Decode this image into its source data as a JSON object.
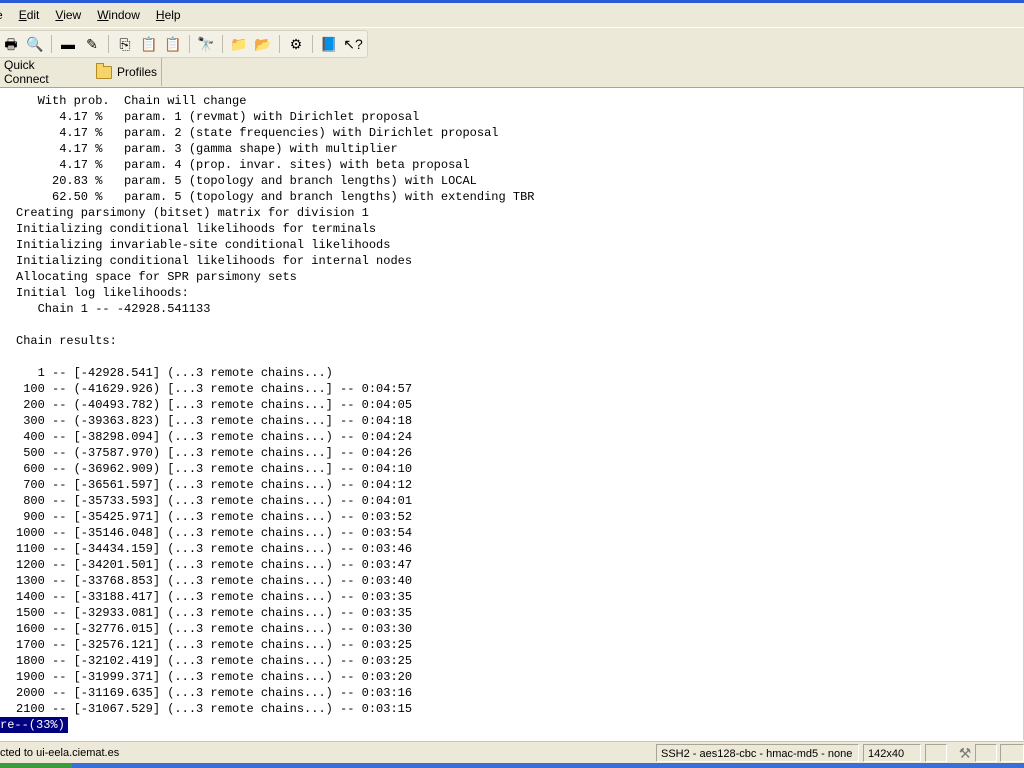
{
  "menu": {
    "items": [
      {
        "label": "e",
        "name": "menu-file-partial"
      },
      {
        "label": "Edit",
        "name": "menu-edit"
      },
      {
        "label": "View",
        "name": "menu-view"
      },
      {
        "label": "Window",
        "name": "menu-window"
      },
      {
        "label": "Help",
        "name": "menu-help"
      }
    ]
  },
  "toolbar": {
    "buttons": [
      {
        "icon": "printer-icon",
        "glyph": "🖶"
      },
      {
        "icon": "print-preview-icon",
        "glyph": "🔍"
      },
      {
        "icon": "disconnect-icon",
        "glyph": "▬"
      },
      {
        "icon": "connect-icon",
        "glyph": "✎"
      },
      {
        "icon": "copy-icon",
        "glyph": "⎘"
      },
      {
        "icon": "paste-icon",
        "glyph": "📋"
      },
      {
        "icon": "paste-alt-icon",
        "glyph": "📋"
      },
      {
        "icon": "find-icon",
        "glyph": "🔭"
      },
      {
        "icon": "new-file-transfer-icon",
        "glyph": "📁"
      },
      {
        "icon": "open-folder-icon",
        "glyph": "📂"
      },
      {
        "icon": "settings-icon",
        "glyph": "⚙"
      },
      {
        "icon": "help-book-icon",
        "glyph": "📘"
      },
      {
        "icon": "whats-this-icon",
        "glyph": "↖?"
      }
    ]
  },
  "quickbar": {
    "quick_connect_label": "Quick Connect",
    "profiles_label": "Profiles"
  },
  "terminal": {
    "lines": [
      "   With prob.  Chain will change",
      "      4.17 %   param. 1 (revmat) with Dirichlet proposal",
      "      4.17 %   param. 2 (state frequencies) with Dirichlet proposal",
      "      4.17 %   param. 3 (gamma shape) with multiplier",
      "      4.17 %   param. 4 (prop. invar. sites) with beta proposal",
      "     20.83 %   param. 5 (topology and branch lengths) with LOCAL",
      "     62.50 %   param. 5 (topology and branch lengths) with extending TBR",
      "Creating parsimony (bitset) matrix for division 1",
      "Initializing conditional likelihoods for terminals",
      "Initializing invariable-site conditional likelihoods",
      "Initializing conditional likelihoods for internal nodes",
      "Allocating space for SPR parsimony sets",
      "Initial log likelihoods:",
      "   Chain 1 -- -42928.541133",
      "",
      "Chain results:",
      "",
      "   1 -- [-42928.541] (...3 remote chains...)",
      " 100 -- (-41629.926) [...3 remote chains...] -- 0:04:57",
      " 200 -- (-40493.782) [...3 remote chains...] -- 0:04:05",
      " 300 -- (-39363.823) [...3 remote chains...] -- 0:04:18",
      " 400 -- [-38298.094] (...3 remote chains...) -- 0:04:24",
      " 500 -- (-37587.970) [...3 remote chains...] -- 0:04:26",
      " 600 -- (-36962.909) [...3 remote chains...] -- 0:04:10",
      " 700 -- [-36561.597] (...3 remote chains...) -- 0:04:12",
      " 800 -- [-35733.593] (...3 remote chains...) -- 0:04:01",
      " 900 -- [-35425.971] (...3 remote chains...) -- 0:03:52",
      "1000 -- [-35146.048] (...3 remote chains...) -- 0:03:54",
      "1100 -- [-34434.159] (...3 remote chains...) -- 0:03:46",
      "1200 -- [-34201.501] (...3 remote chains...) -- 0:03:47",
      "1300 -- [-33768.853] (...3 remote chains...) -- 0:03:40",
      "1400 -- [-33188.417] (...3 remote chains...) -- 0:03:35",
      "1500 -- [-32933.081] (...3 remote chains...) -- 0:03:35",
      "1600 -- [-32776.015] (...3 remote chains...) -- 0:03:30",
      "1700 -- [-32576.121] (...3 remote chains...) -- 0:03:25",
      "1800 -- [-32102.419] (...3 remote chains...) -- 0:03:25",
      "1900 -- [-31999.371] (...3 remote chains...) -- 0:03:20",
      "2000 -- [-31169.635] (...3 remote chains...) -- 0:03:16",
      "2100 -- [-31067.529] (...3 remote chains...) -- 0:03:15"
    ],
    "more_prompt": "re--(33%)"
  },
  "status": {
    "connection": "cted to ui-eela.ciemat.es",
    "cipher": "SSH2 - aes128-cbc - hmac-md5 - none",
    "size": "142x40"
  },
  "colors": {
    "chrome": "#ece9d8",
    "prompt_bg": "#000080",
    "taskbar": "#3a6fd8"
  }
}
